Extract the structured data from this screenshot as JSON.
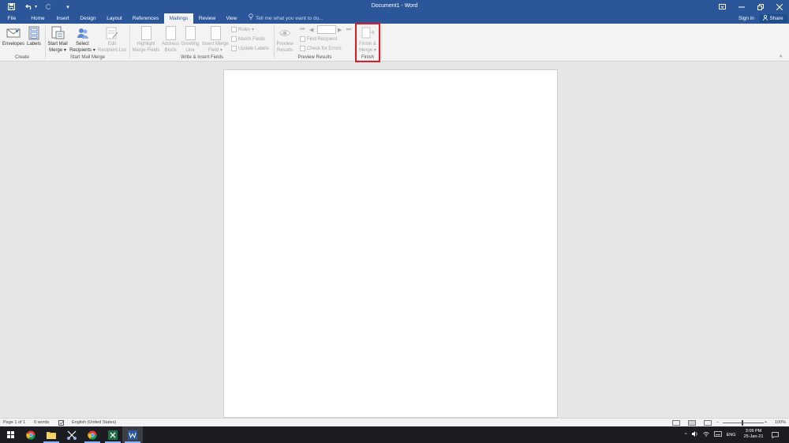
{
  "title_bar": {
    "doc_title": "Document1 - Word",
    "icons": [
      "save-icon",
      "undo-icon",
      "redo-icon",
      "customize-qat-icon",
      "ribbon-display-icon",
      "minimize-icon",
      "restore-icon",
      "close-icon"
    ],
    "accent": "#2b579a"
  },
  "tabs": [
    "File",
    "Home",
    "Insert",
    "Design",
    "Layout",
    "References",
    "Mailings",
    "Review",
    "View"
  ],
  "active_tab": "Mailings",
  "tell_me": "Tell me what you want to do...",
  "account": {
    "sign_in": "Sign in",
    "share": "Share"
  },
  "ribbon": {
    "create": {
      "label": "Create",
      "envelopes": "Envelopes",
      "labels": "Labels"
    },
    "start": {
      "label": "Start Mail Merge",
      "start_mail_merge": [
        "Start Mail",
        "Merge ▾"
      ],
      "select_recipients": [
        "Select",
        "Recipients ▾"
      ],
      "edit_recipient_list": [
        "Edit",
        "Recipient List"
      ]
    },
    "write": {
      "label": "Write & Insert Fields",
      "highlight": [
        "Highlight",
        "Merge Fields"
      ],
      "address": [
        "Address",
        "Block"
      ],
      "greeting": [
        "Greeting",
        "Line"
      ],
      "insert_merge_field": [
        "Insert Merge",
        "Field ▾"
      ],
      "rules": "Rules ▾",
      "match_fields": "Match Fields",
      "update_labels": "Update Labels"
    },
    "preview": {
      "label": "Preview Results",
      "preview_results": [
        "Preview",
        "Results"
      ],
      "find_recipient": "Find Recipient",
      "check_errors": "Check for Errors",
      "record_value": ""
    },
    "finish": {
      "label": "Finish",
      "finish_merge": [
        "Finish &",
        "Merge ▾"
      ],
      "highlight_color": "#e01b24"
    }
  },
  "status_bar": {
    "page": "Page 1 of 1",
    "words": "0 words",
    "language": "English (United States)",
    "zoom": "100%"
  },
  "taskbar": {
    "apps": [
      "windows-start",
      "chrome",
      "file-explorer",
      "snipping-tool",
      "chrome",
      "excel",
      "word"
    ],
    "active_app": "word",
    "lang": "ENG",
    "time": "3:09 PM",
    "date": "25-Jan-21"
  }
}
